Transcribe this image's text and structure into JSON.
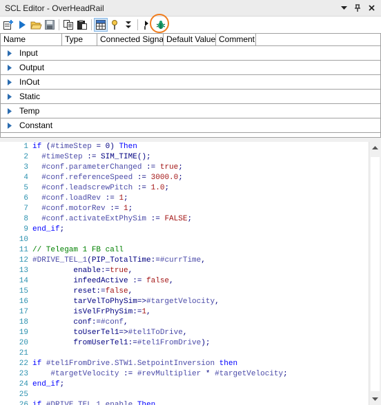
{
  "window": {
    "title": "SCL Editor  - OverHeadRail",
    "icons": [
      "dropdown-icon",
      "pin-icon",
      "close-icon"
    ]
  },
  "toolbar": {
    "buttons": [
      {
        "name": "insert-block-icon"
      },
      {
        "name": "run-icon"
      },
      {
        "name": "open-folder-icon"
      },
      {
        "name": "save-icon"
      },
      {
        "name": "copy-icon"
      },
      {
        "name": "paste-icon"
      },
      {
        "name": "grid-view-icon"
      },
      {
        "name": "breakpoint-icon"
      },
      {
        "name": "step-icon"
      },
      {
        "name": "debug-bug-icon"
      }
    ],
    "highlight_color": "#f07d1e"
  },
  "interface": {
    "columns": [
      "Name",
      "Type",
      "Connected Signal",
      "Default Value",
      "Comment"
    ],
    "sections": [
      "Input",
      "Output",
      "InOut",
      "Static",
      "Temp",
      "Constant"
    ]
  },
  "code": {
    "lines": [
      {
        "n": "1",
        "t": [
          [
            "kw",
            "if "
          ],
          [
            "txt",
            "("
          ],
          [
            "var",
            "#timeStep"
          ],
          [
            "txt",
            " = 0) "
          ],
          [
            "kw",
            "Then"
          ]
        ]
      },
      {
        "n": "2",
        "t": [
          [
            "txt",
            "  "
          ],
          [
            "var",
            "#timeStep"
          ],
          [
            "txt",
            " := SIM_TIME();"
          ]
        ]
      },
      {
        "n": "3",
        "t": [
          [
            "txt",
            "  "
          ],
          [
            "var",
            "#conf.parameterChanged"
          ],
          [
            "txt",
            " := "
          ],
          [
            "lit",
            "true"
          ],
          [
            "txt",
            ";"
          ]
        ]
      },
      {
        "n": "4",
        "t": [
          [
            "txt",
            "  "
          ],
          [
            "var",
            "#conf.referenceSpeed"
          ],
          [
            "txt",
            " := "
          ],
          [
            "lit",
            "3000.0"
          ],
          [
            "txt",
            ";"
          ]
        ]
      },
      {
        "n": "5",
        "t": [
          [
            "txt",
            "  "
          ],
          [
            "var",
            "#conf.leadscrewPitch"
          ],
          [
            "txt",
            " := "
          ],
          [
            "lit",
            "1.0"
          ],
          [
            "txt",
            ";"
          ]
        ]
      },
      {
        "n": "6",
        "t": [
          [
            "txt",
            "  "
          ],
          [
            "var",
            "#conf.loadRev"
          ],
          [
            "txt",
            " := "
          ],
          [
            "lit",
            "1"
          ],
          [
            "txt",
            ";"
          ]
        ]
      },
      {
        "n": "7",
        "t": [
          [
            "txt",
            "  "
          ],
          [
            "var",
            "#conf.motorRev"
          ],
          [
            "txt",
            " := "
          ],
          [
            "lit",
            "1"
          ],
          [
            "txt",
            ";"
          ]
        ]
      },
      {
        "n": "8",
        "t": [
          [
            "txt",
            "  "
          ],
          [
            "var",
            "#conf.activateExtPhySim"
          ],
          [
            "txt",
            " := "
          ],
          [
            "lit",
            "FALSE"
          ],
          [
            "txt",
            ";"
          ]
        ]
      },
      {
        "n": "9",
        "t": [
          [
            "kw",
            "end_if"
          ],
          [
            "txt",
            ";"
          ]
        ]
      },
      {
        "n": "10",
        "t": []
      },
      {
        "n": "11",
        "t": [
          [
            "cmt",
            "// Telegam 1 FB call"
          ]
        ]
      },
      {
        "n": "12",
        "t": [
          [
            "var",
            "#DRIVE_TEL_1"
          ],
          [
            "txt",
            "(PIP_TotalTime:="
          ],
          [
            "var",
            "#currTime"
          ],
          [
            "txt",
            ","
          ]
        ]
      },
      {
        "n": "13",
        "t": [
          [
            "txt",
            "         enable:="
          ],
          [
            "lit",
            "true"
          ],
          [
            "txt",
            ","
          ]
        ]
      },
      {
        "n": "14",
        "t": [
          [
            "txt",
            "         infeedActive := "
          ],
          [
            "lit",
            "false"
          ],
          [
            "txt",
            ","
          ]
        ]
      },
      {
        "n": "15",
        "t": [
          [
            "txt",
            "         reset:="
          ],
          [
            "lit",
            "false"
          ],
          [
            "txt",
            ","
          ]
        ]
      },
      {
        "n": "16",
        "t": [
          [
            "txt",
            "         tarVelToPhySim=>"
          ],
          [
            "var",
            "#targetVelocity"
          ],
          [
            "txt",
            ","
          ]
        ]
      },
      {
        "n": "17",
        "t": [
          [
            "txt",
            "         isVelFrPhySim:="
          ],
          [
            "lit",
            "1"
          ],
          [
            "txt",
            ","
          ]
        ]
      },
      {
        "n": "18",
        "t": [
          [
            "txt",
            "         conf:="
          ],
          [
            "var",
            "#conf"
          ],
          [
            "txt",
            ","
          ]
        ]
      },
      {
        "n": "19",
        "t": [
          [
            "txt",
            "         toUserTel1=>"
          ],
          [
            "var",
            "#tel1ToDrive"
          ],
          [
            "txt",
            ","
          ]
        ]
      },
      {
        "n": "20",
        "t": [
          [
            "txt",
            "         fromUserTel1:="
          ],
          [
            "var",
            "#tel1FromDrive"
          ],
          [
            "txt",
            ");"
          ]
        ]
      },
      {
        "n": "21",
        "t": []
      },
      {
        "n": "22",
        "t": [
          [
            "kw",
            "if "
          ],
          [
            "var",
            "#tel1FromDrive.STW1.SetpointInversion"
          ],
          [
            "kw",
            " then"
          ]
        ]
      },
      {
        "n": "23",
        "t": [
          [
            "txt",
            "    "
          ],
          [
            "var",
            "#targetVelocity"
          ],
          [
            "txt",
            " := "
          ],
          [
            "var",
            "#revMultiplier"
          ],
          [
            "txt",
            " * "
          ],
          [
            "var",
            "#targetVelocity"
          ],
          [
            "txt",
            ";"
          ]
        ]
      },
      {
        "n": "24",
        "t": [
          [
            "kw",
            "end_if"
          ],
          [
            "txt",
            ";"
          ]
        ]
      },
      {
        "n": "25",
        "t": []
      },
      {
        "n": "26",
        "t": [
          [
            "kw",
            "if "
          ],
          [
            "var",
            "#DRIVE_TEL_1.enable"
          ],
          [
            "kw",
            " Then"
          ]
        ]
      }
    ]
  }
}
